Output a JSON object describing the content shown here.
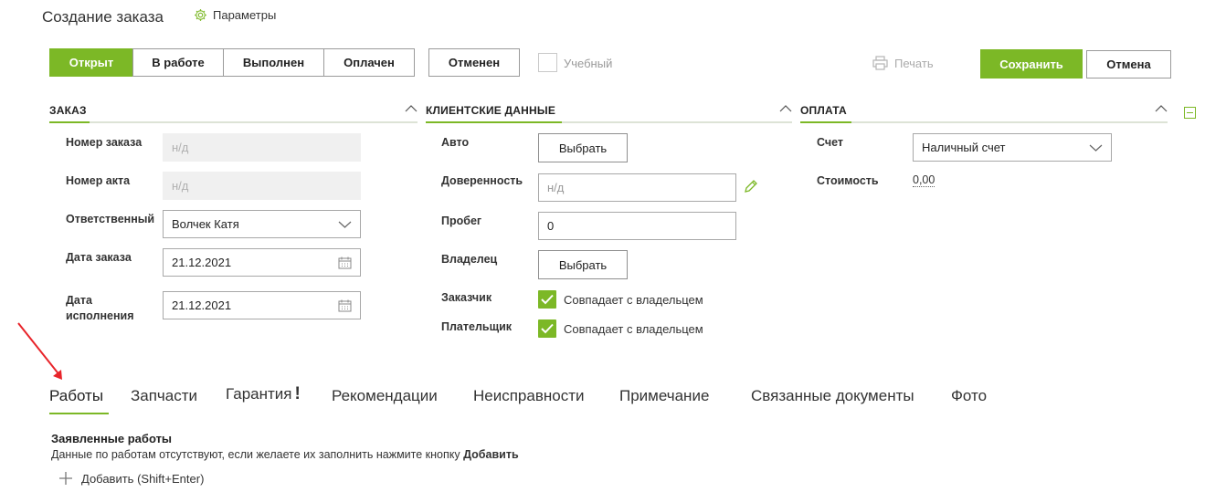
{
  "header": {
    "title": "Создание заказа",
    "params_label": "Параметры"
  },
  "status_buttons": [
    {
      "label": "Открыт",
      "active": true
    },
    {
      "label": "В работе",
      "active": false
    },
    {
      "label": "Выполнен",
      "active": false
    },
    {
      "label": "Оплачен",
      "active": false
    }
  ],
  "cancel_status_label": "Отменен",
  "learning_checkbox": {
    "label": "Учебный",
    "checked": false
  },
  "print_label": "Печать",
  "save_label": "Сохранить",
  "cancel_label": "Отмена",
  "order": {
    "title": "ЗАКАЗ",
    "number_label": "Номер заказа",
    "number_value": "н/д",
    "act_label": "Номер акта",
    "act_value": "н/д",
    "responsible_label": "Ответственный",
    "responsible_value": "Волчек Катя",
    "order_date_label": "Дата заказа",
    "order_date_value": "21.12.2021",
    "exec_date_label_1": "Дата",
    "exec_date_label_2": "исполнения",
    "exec_date_value": "21.12.2021"
  },
  "client": {
    "title": "КЛИЕНТСКИЕ ДАННЫЕ",
    "car_label": "Авто",
    "car_button": "Выбрать",
    "proxy_label": "Доверенность",
    "proxy_placeholder": "н/д",
    "mileage_label": "Пробег",
    "mileage_value": "0",
    "owner_label": "Владелец",
    "owner_button": "Выбрать",
    "customer_label": "Заказчик",
    "customer_check_label": "Совпадает с владельцем",
    "payer_label": "Плательщик",
    "payer_check_label": "Совпадает с владельцем"
  },
  "payment": {
    "title": "ОПЛАТА",
    "account_label": "Счет",
    "account_value": "Наличный счет",
    "cost_label": "Стоимость",
    "cost_value": "0,00"
  },
  "tabs": [
    {
      "label": "Работы",
      "active": true
    },
    {
      "label": "Запчасти"
    },
    {
      "label": "Гарантия"
    },
    {
      "label": "Рекомендации"
    },
    {
      "label": "Неисправности"
    },
    {
      "label": "Примечание"
    },
    {
      "label": "Связанные документы"
    },
    {
      "label": "Фото"
    }
  ],
  "warranty_mark": "!",
  "works": {
    "title": "Заявленные работы",
    "note_prefix": "Данные по работам отсутствуют, если желаете их заполнить нажмите кнопку ",
    "note_bold": "Добавить",
    "add_label": "Добавить (Shift+Enter)"
  },
  "colors": {
    "accent": "#7cb826",
    "annotation_arrow": "#e8242a"
  }
}
